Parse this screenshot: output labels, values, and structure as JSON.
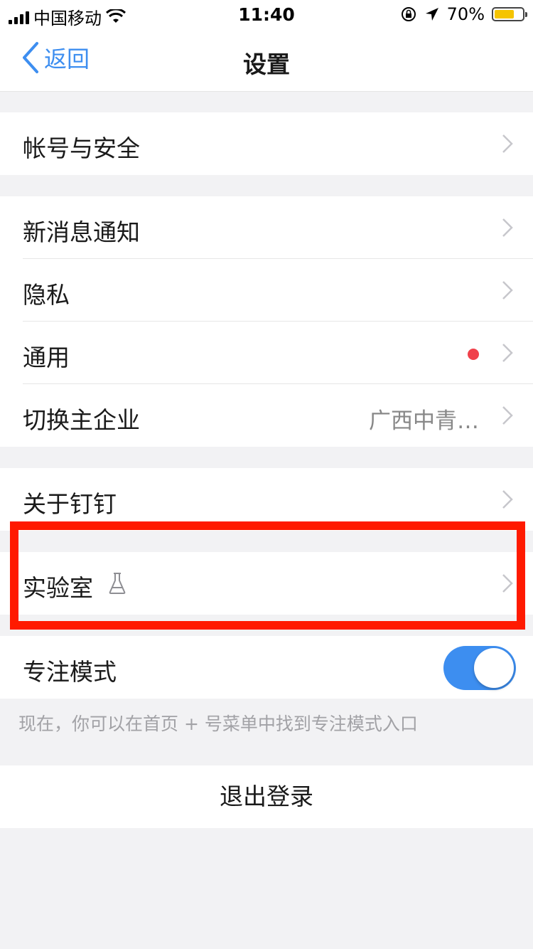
{
  "status_bar": {
    "carrier": "中国移动",
    "time": "11:40",
    "battery": "70%",
    "battery_level": 0.7,
    "battery_color": "#f5c400"
  },
  "nav": {
    "back_label": "返回",
    "title": "设置"
  },
  "settings": {
    "account_security": "帐号与安全",
    "new_message_notice": "新消息通知",
    "privacy": "隐私",
    "general": "通用",
    "switch_enterprise": "切换主企业",
    "switch_enterprise_value": "广西中青…",
    "about": "关于钉钉",
    "lab": "实验室",
    "focus_mode": "专注模式",
    "focus_mode_on": true,
    "focus_hint": "现在，你可以在首页 + 号菜单中找到专注模式入口",
    "logout": "退出登录"
  },
  "colors": {
    "accent": "#3d8ef0",
    "highlight_frame": "#ff1a00",
    "badge_dot": "#f0414b"
  }
}
